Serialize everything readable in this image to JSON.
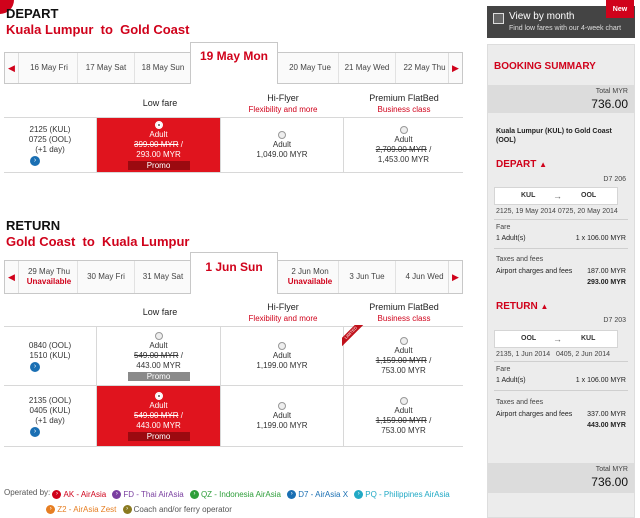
{
  "depart": {
    "title": "DEPART",
    "route": "Kuala Lumpur  to  Gold Coast",
    "dates": [
      {
        "label": "16 May Fri",
        "unavailable": ""
      },
      {
        "label": "17 May Sat",
        "unavailable": ""
      },
      {
        "label": "18 May Sun",
        "unavailable": ""
      },
      {
        "label": "20 May Tue",
        "unavailable": ""
      },
      {
        "label": "21 May Wed",
        "unavailable": ""
      },
      {
        "label": "22 May Thu",
        "unavailable": ""
      }
    ],
    "selected_date": "19 May Mon",
    "flights": [
      {
        "dep": "2125 (KUL)",
        "arr": "0725 (OOL)",
        "extra": "(+1 day)",
        "low": {
          "pax": "Adult",
          "old": "399.00 MYR",
          "sep": "/",
          "price": "293.00 MYR",
          "promo": "Promo"
        },
        "hiflyer": {
          "pax": "Adult",
          "old": "",
          "price": "1,049.00 MYR",
          "promo": ""
        },
        "flatbed": {
          "pax": "Adult",
          "old": "2,709.00 MYR",
          "sep": "/",
          "price": "1,453.00 MYR",
          "promo": ""
        }
      }
    ]
  },
  "return": {
    "title": "RETURN",
    "route": "Gold Coast  to  Kuala Lumpur",
    "dates": [
      {
        "label": "29 May Thu",
        "unavailable": "Unavailable"
      },
      {
        "label": "30 May Fri",
        "unavailable": ""
      },
      {
        "label": "31 May Sat",
        "unavailable": ""
      },
      {
        "label": "2 Jun Mon",
        "unavailable": "Unavailable"
      },
      {
        "label": "3 Jun Tue",
        "unavailable": ""
      },
      {
        "label": "4 Jun Wed",
        "unavailable": ""
      }
    ],
    "selected_date": "1 Jun Sun",
    "flights": [
      {
        "dep": "0840 (OOL)",
        "arr": "1510 (KUL)",
        "extra": "",
        "low": {
          "pax": "Adult",
          "old": "549.00 MYR",
          "sep": "/",
          "price": "443.00 MYR",
          "promo": "Promo"
        },
        "hiflyer": {
          "pax": "Adult",
          "price": "1,199.00 MYR"
        },
        "flatbed": {
          "pax": "Adult",
          "old": "1,159.00 MYR",
          "sep": "/",
          "price": "753.00 MYR",
          "ribbon": "LIMITED"
        }
      },
      {
        "dep": "2135 (OOL)",
        "arr": "0405 (KUL)",
        "extra": "(+1 day)",
        "low": {
          "pax": "Adult",
          "old": "549.00 MYR",
          "sep": "/",
          "price": "443.00 MYR",
          "promo": "Promo"
        },
        "hiflyer": {
          "pax": "Adult",
          "price": "1,199.00 MYR"
        },
        "flatbed": {
          "pax": "Adult",
          "old": "1,159.00 MYR",
          "sep": "/",
          "price": "753.00 MYR"
        }
      }
    ]
  },
  "fare_headers": {
    "low": "Low fare",
    "hiflyer": "Hi-Flyer",
    "hiflyer_sub": "Flexibility and more",
    "flatbed": "Premium FlatBed",
    "flatbed_sub": "Business class"
  },
  "legend": {
    "label": "Operated by:",
    "items": [
      {
        "text": "AK - AirAsia",
        "color": "#d0021b",
        "glyph": "›"
      },
      {
        "text": "FD - Thai AirAsia",
        "color": "#7a3fa0",
        "glyph": "›"
      },
      {
        "text": "QZ - Indonesia AirAsia",
        "color": "#2e9e3a",
        "glyph": "›"
      },
      {
        "text": "D7 - AirAsia X",
        "color": "#1a6fb3",
        "glyph": "›"
      },
      {
        "text": "PQ - Philippines AirAsia",
        "color": "#21a9c5",
        "glyph": "›"
      },
      {
        "text": "Z2 - AirAsia Zest",
        "color": "#e67e22",
        "glyph": "›"
      },
      {
        "text": "Coach and/or ferry operator",
        "color": "#8a7a20",
        "glyph": "›"
      }
    ]
  },
  "sidebar": {
    "new_badge": "New",
    "view_month": "View by month",
    "view_month_sub": "Find low fares with our 4-week chart",
    "summary_title": "BOOKING SUMMARY",
    "total_label": "Total MYR",
    "total": "736.00",
    "trip": "Kuala Lumpur (KUL) to Gold Coast (OOL)",
    "depart": {
      "title": "DEPART",
      "flight_no": "D7 206",
      "from": "KUL",
      "to": "OOL",
      "times": "2125, 19 May 2014 0725, 20 May 2014",
      "fare_label": "Fare",
      "adults": "1 Adult(s)",
      "fare_calc": "1 x 106.00 MYR",
      "tax_label": "Taxes and fees",
      "airport_label": "Airport charges and fees",
      "airport_amt": "187.00 MYR",
      "subtotal": "293.00 MYR"
    },
    "return": {
      "title": "RETURN",
      "flight_no": "D7 203",
      "from": "OOL",
      "to": "KUL",
      "times": "2135, 1 Jun 2014   0405, 2 Jun 2014",
      "fare_label": "Fare",
      "adults": "1 Adult(s)",
      "fare_calc": "1 x 106.00 MYR",
      "tax_label": "Taxes and fees",
      "airport_label": "Airport charges and fees",
      "airport_amt": "337.00 MYR",
      "subtotal": "443.00 MYR"
    }
  }
}
